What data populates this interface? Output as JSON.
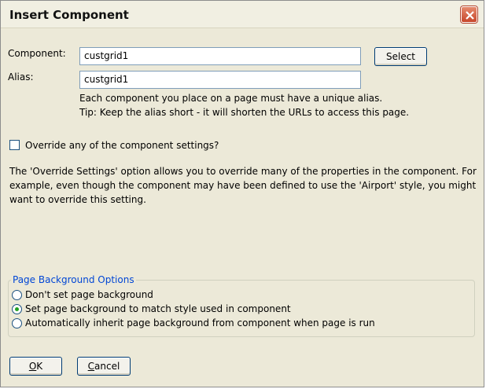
{
  "window": {
    "title": "Insert Component"
  },
  "form": {
    "component_label": "Component:",
    "component_value": "custgrid1",
    "select_button": "Select",
    "alias_label": "Alias:",
    "alias_value": "custgrid1",
    "alias_hint_1": "Each component you place on a page must have a unique alias.",
    "alias_hint_2": "Tip: Keep the alias short - it will shorten the URLs to access this page."
  },
  "override": {
    "checkbox_label": "Override any of the component settings?",
    "checked": false,
    "description": "The 'Override Settings' option allows you to override many of the properties in the component. For example, even though the component may have been defined to use the 'Airport' style, you might want to override this setting."
  },
  "background_options": {
    "title": "Page Background Options",
    "options": [
      {
        "label": "Don't set page background",
        "selected": false
      },
      {
        "label": "Set page background to match style used in component",
        "selected": true
      },
      {
        "label": "Automatically inherit page background from component when page is run",
        "selected": false
      }
    ]
  },
  "footer": {
    "ok_accel": "O",
    "ok_rest": "K",
    "cancel_accel": "C",
    "cancel_rest": "ancel"
  },
  "colors": {
    "group_title": "#0046d5",
    "radio_selected": "#21a121",
    "close_button": "#c7462a"
  }
}
